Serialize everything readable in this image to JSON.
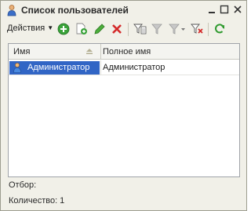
{
  "window": {
    "title": "Список пользователей",
    "icon": "user-list-icon"
  },
  "toolbar": {
    "actions_label": "Действия",
    "buttons": [
      {
        "icon": "add-icon"
      },
      {
        "icon": "copy-icon"
      },
      {
        "icon": "edit-icon"
      },
      {
        "icon": "delete-icon"
      },
      {
        "icon": "filter-settings-icon"
      },
      {
        "icon": "filter-icon"
      },
      {
        "icon": "filter-dropdown-icon"
      },
      {
        "icon": "clear-filter-icon"
      },
      {
        "icon": "refresh-icon"
      }
    ]
  },
  "table": {
    "columns": [
      "Имя",
      "Полное имя"
    ],
    "rows": [
      {
        "name": "Администратор",
        "full_name": "Администратор",
        "selected": true
      }
    ]
  },
  "footer": {
    "filter_label": "Отбор:",
    "count_label": "Количество: 1"
  },
  "colors": {
    "selection": "#3165c5",
    "window_bg": "#f1f0e8"
  }
}
